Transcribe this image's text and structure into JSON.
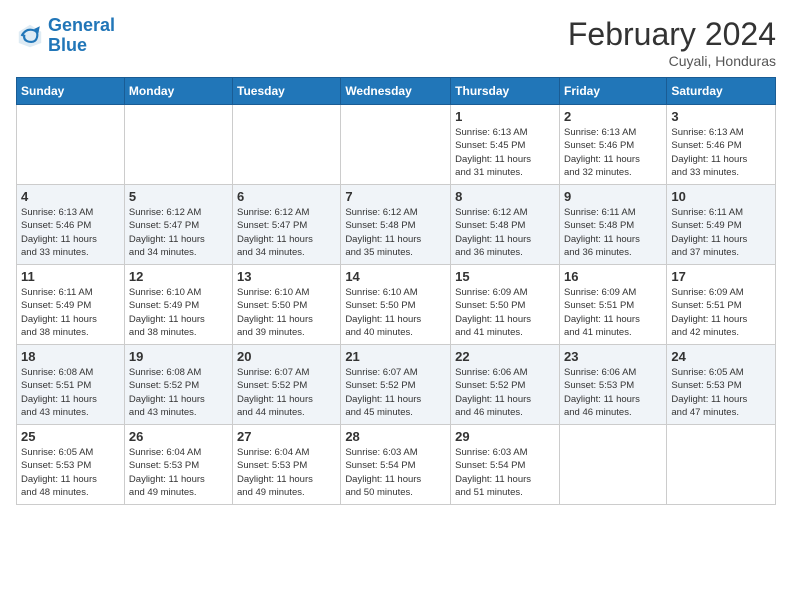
{
  "header": {
    "logo_line1": "General",
    "logo_line2": "Blue",
    "month": "February 2024",
    "location": "Cuyali, Honduras"
  },
  "days_of_week": [
    "Sunday",
    "Monday",
    "Tuesday",
    "Wednesday",
    "Thursday",
    "Friday",
    "Saturday"
  ],
  "weeks": [
    [
      {
        "num": "",
        "info": ""
      },
      {
        "num": "",
        "info": ""
      },
      {
        "num": "",
        "info": ""
      },
      {
        "num": "",
        "info": ""
      },
      {
        "num": "1",
        "info": "Sunrise: 6:13 AM\nSunset: 5:45 PM\nDaylight: 11 hours\nand 31 minutes."
      },
      {
        "num": "2",
        "info": "Sunrise: 6:13 AM\nSunset: 5:46 PM\nDaylight: 11 hours\nand 32 minutes."
      },
      {
        "num": "3",
        "info": "Sunrise: 6:13 AM\nSunset: 5:46 PM\nDaylight: 11 hours\nand 33 minutes."
      }
    ],
    [
      {
        "num": "4",
        "info": "Sunrise: 6:13 AM\nSunset: 5:46 PM\nDaylight: 11 hours\nand 33 minutes."
      },
      {
        "num": "5",
        "info": "Sunrise: 6:12 AM\nSunset: 5:47 PM\nDaylight: 11 hours\nand 34 minutes."
      },
      {
        "num": "6",
        "info": "Sunrise: 6:12 AM\nSunset: 5:47 PM\nDaylight: 11 hours\nand 34 minutes."
      },
      {
        "num": "7",
        "info": "Sunrise: 6:12 AM\nSunset: 5:48 PM\nDaylight: 11 hours\nand 35 minutes."
      },
      {
        "num": "8",
        "info": "Sunrise: 6:12 AM\nSunset: 5:48 PM\nDaylight: 11 hours\nand 36 minutes."
      },
      {
        "num": "9",
        "info": "Sunrise: 6:11 AM\nSunset: 5:48 PM\nDaylight: 11 hours\nand 36 minutes."
      },
      {
        "num": "10",
        "info": "Sunrise: 6:11 AM\nSunset: 5:49 PM\nDaylight: 11 hours\nand 37 minutes."
      }
    ],
    [
      {
        "num": "11",
        "info": "Sunrise: 6:11 AM\nSunset: 5:49 PM\nDaylight: 11 hours\nand 38 minutes."
      },
      {
        "num": "12",
        "info": "Sunrise: 6:10 AM\nSunset: 5:49 PM\nDaylight: 11 hours\nand 38 minutes."
      },
      {
        "num": "13",
        "info": "Sunrise: 6:10 AM\nSunset: 5:50 PM\nDaylight: 11 hours\nand 39 minutes."
      },
      {
        "num": "14",
        "info": "Sunrise: 6:10 AM\nSunset: 5:50 PM\nDaylight: 11 hours\nand 40 minutes."
      },
      {
        "num": "15",
        "info": "Sunrise: 6:09 AM\nSunset: 5:50 PM\nDaylight: 11 hours\nand 41 minutes."
      },
      {
        "num": "16",
        "info": "Sunrise: 6:09 AM\nSunset: 5:51 PM\nDaylight: 11 hours\nand 41 minutes."
      },
      {
        "num": "17",
        "info": "Sunrise: 6:09 AM\nSunset: 5:51 PM\nDaylight: 11 hours\nand 42 minutes."
      }
    ],
    [
      {
        "num": "18",
        "info": "Sunrise: 6:08 AM\nSunset: 5:51 PM\nDaylight: 11 hours\nand 43 minutes."
      },
      {
        "num": "19",
        "info": "Sunrise: 6:08 AM\nSunset: 5:52 PM\nDaylight: 11 hours\nand 43 minutes."
      },
      {
        "num": "20",
        "info": "Sunrise: 6:07 AM\nSunset: 5:52 PM\nDaylight: 11 hours\nand 44 minutes."
      },
      {
        "num": "21",
        "info": "Sunrise: 6:07 AM\nSunset: 5:52 PM\nDaylight: 11 hours\nand 45 minutes."
      },
      {
        "num": "22",
        "info": "Sunrise: 6:06 AM\nSunset: 5:52 PM\nDaylight: 11 hours\nand 46 minutes."
      },
      {
        "num": "23",
        "info": "Sunrise: 6:06 AM\nSunset: 5:53 PM\nDaylight: 11 hours\nand 46 minutes."
      },
      {
        "num": "24",
        "info": "Sunrise: 6:05 AM\nSunset: 5:53 PM\nDaylight: 11 hours\nand 47 minutes."
      }
    ],
    [
      {
        "num": "25",
        "info": "Sunrise: 6:05 AM\nSunset: 5:53 PM\nDaylight: 11 hours\nand 48 minutes."
      },
      {
        "num": "26",
        "info": "Sunrise: 6:04 AM\nSunset: 5:53 PM\nDaylight: 11 hours\nand 49 minutes."
      },
      {
        "num": "27",
        "info": "Sunrise: 6:04 AM\nSunset: 5:53 PM\nDaylight: 11 hours\nand 49 minutes."
      },
      {
        "num": "28",
        "info": "Sunrise: 6:03 AM\nSunset: 5:54 PM\nDaylight: 11 hours\nand 50 minutes."
      },
      {
        "num": "29",
        "info": "Sunrise: 6:03 AM\nSunset: 5:54 PM\nDaylight: 11 hours\nand 51 minutes."
      },
      {
        "num": "",
        "info": ""
      },
      {
        "num": "",
        "info": ""
      }
    ]
  ]
}
